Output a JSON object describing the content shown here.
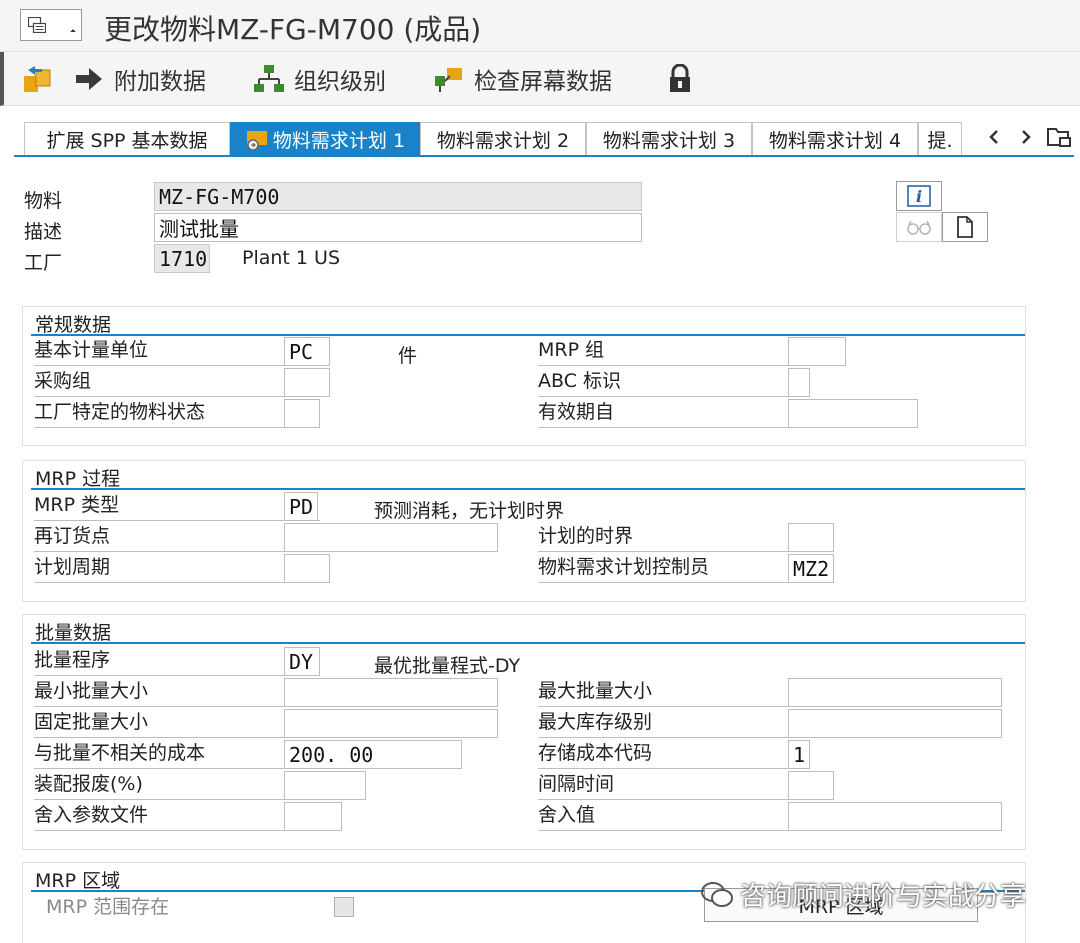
{
  "window": {
    "title": "更改物料MZ-FG-M700 (成品)"
  },
  "toolbar": {
    "additional_data": "附加数据",
    "org_levels": "组织级别",
    "check_screen_data": "检查屏幕数据"
  },
  "tabs": [
    {
      "label": "扩展 SPP 基本数据",
      "active": false
    },
    {
      "label": "物料需求计划 1",
      "active": true
    },
    {
      "label": "物料需求计划 2",
      "active": false
    },
    {
      "label": "物料需求计划 3",
      "active": false
    },
    {
      "label": "物料需求计划 4",
      "active": false
    },
    {
      "label": "提.",
      "active": false
    }
  ],
  "header": {
    "material_label": "物料",
    "material_value": "MZ-FG-M700",
    "description_label": "描述",
    "description_value": "测试批量",
    "plant_label": "工厂",
    "plant_value": "1710",
    "plant_name": "Plant 1 US"
  },
  "general": {
    "title": "常规数据",
    "base_uom_label": "基本计量单位",
    "base_uom_value": "PC",
    "base_uom_text": "件",
    "mrp_group_label": "MRP 组",
    "mrp_group_value": "",
    "purchasing_group_label": "采购组",
    "purchasing_group_value": "",
    "abc_label": "ABC 标识",
    "abc_value": "",
    "plant_status_label": "工厂特定的物料状态",
    "plant_status_value": "",
    "valid_from_label": "有效期自",
    "valid_from_value": ""
  },
  "mrp_procedure": {
    "title": "MRP 过程",
    "mrp_type_label": "MRP 类型",
    "mrp_type_value": "PD",
    "mrp_type_text": "预测消耗，无计划时界",
    "reorder_point_label": "再订货点",
    "reorder_point_value": "",
    "planning_time_fence_label": "计划的时界",
    "planning_time_fence_value": "",
    "planning_cycle_label": "计划周期",
    "planning_cycle_value": "",
    "mrp_controller_label": "物料需求计划控制员",
    "mrp_controller_value": "MZ2"
  },
  "lot_size": {
    "title": "批量数据",
    "procedure_label": "批量程序",
    "procedure_value": "DY",
    "procedure_text": "最优批量程式-DY",
    "min_lot_label": "最小批量大小",
    "min_lot_value": "",
    "max_lot_label": "最大批量大小",
    "max_lot_value": "",
    "fixed_lot_label": "固定批量大小",
    "fixed_lot_value": "",
    "max_stock_label": "最大库存级别",
    "max_stock_value": "",
    "lot_independent_cost_label": "与批量不相关的成本",
    "lot_independent_cost_value": "200. 00",
    "storage_cost_code_label": "存储成本代码",
    "storage_cost_code_value": "1",
    "assembly_scrap_label": "装配报废(%)",
    "assembly_scrap_value": "",
    "takt_time_label": "间隔时间",
    "takt_time_value": "",
    "rounding_profile_label": "舍入参数文件",
    "rounding_profile_value": "",
    "rounding_value_label": "舍入值",
    "rounding_value_value": ""
  },
  "mrp_area": {
    "title": "MRP 区域",
    "exists_label": "MRP  范围存在",
    "button_label": "MRP 区域"
  },
  "watermark": {
    "text": "咨询顾问进阶与实战分享"
  },
  "colors": {
    "accent": "#1a82c8",
    "read_only": "#e8e8e8"
  }
}
